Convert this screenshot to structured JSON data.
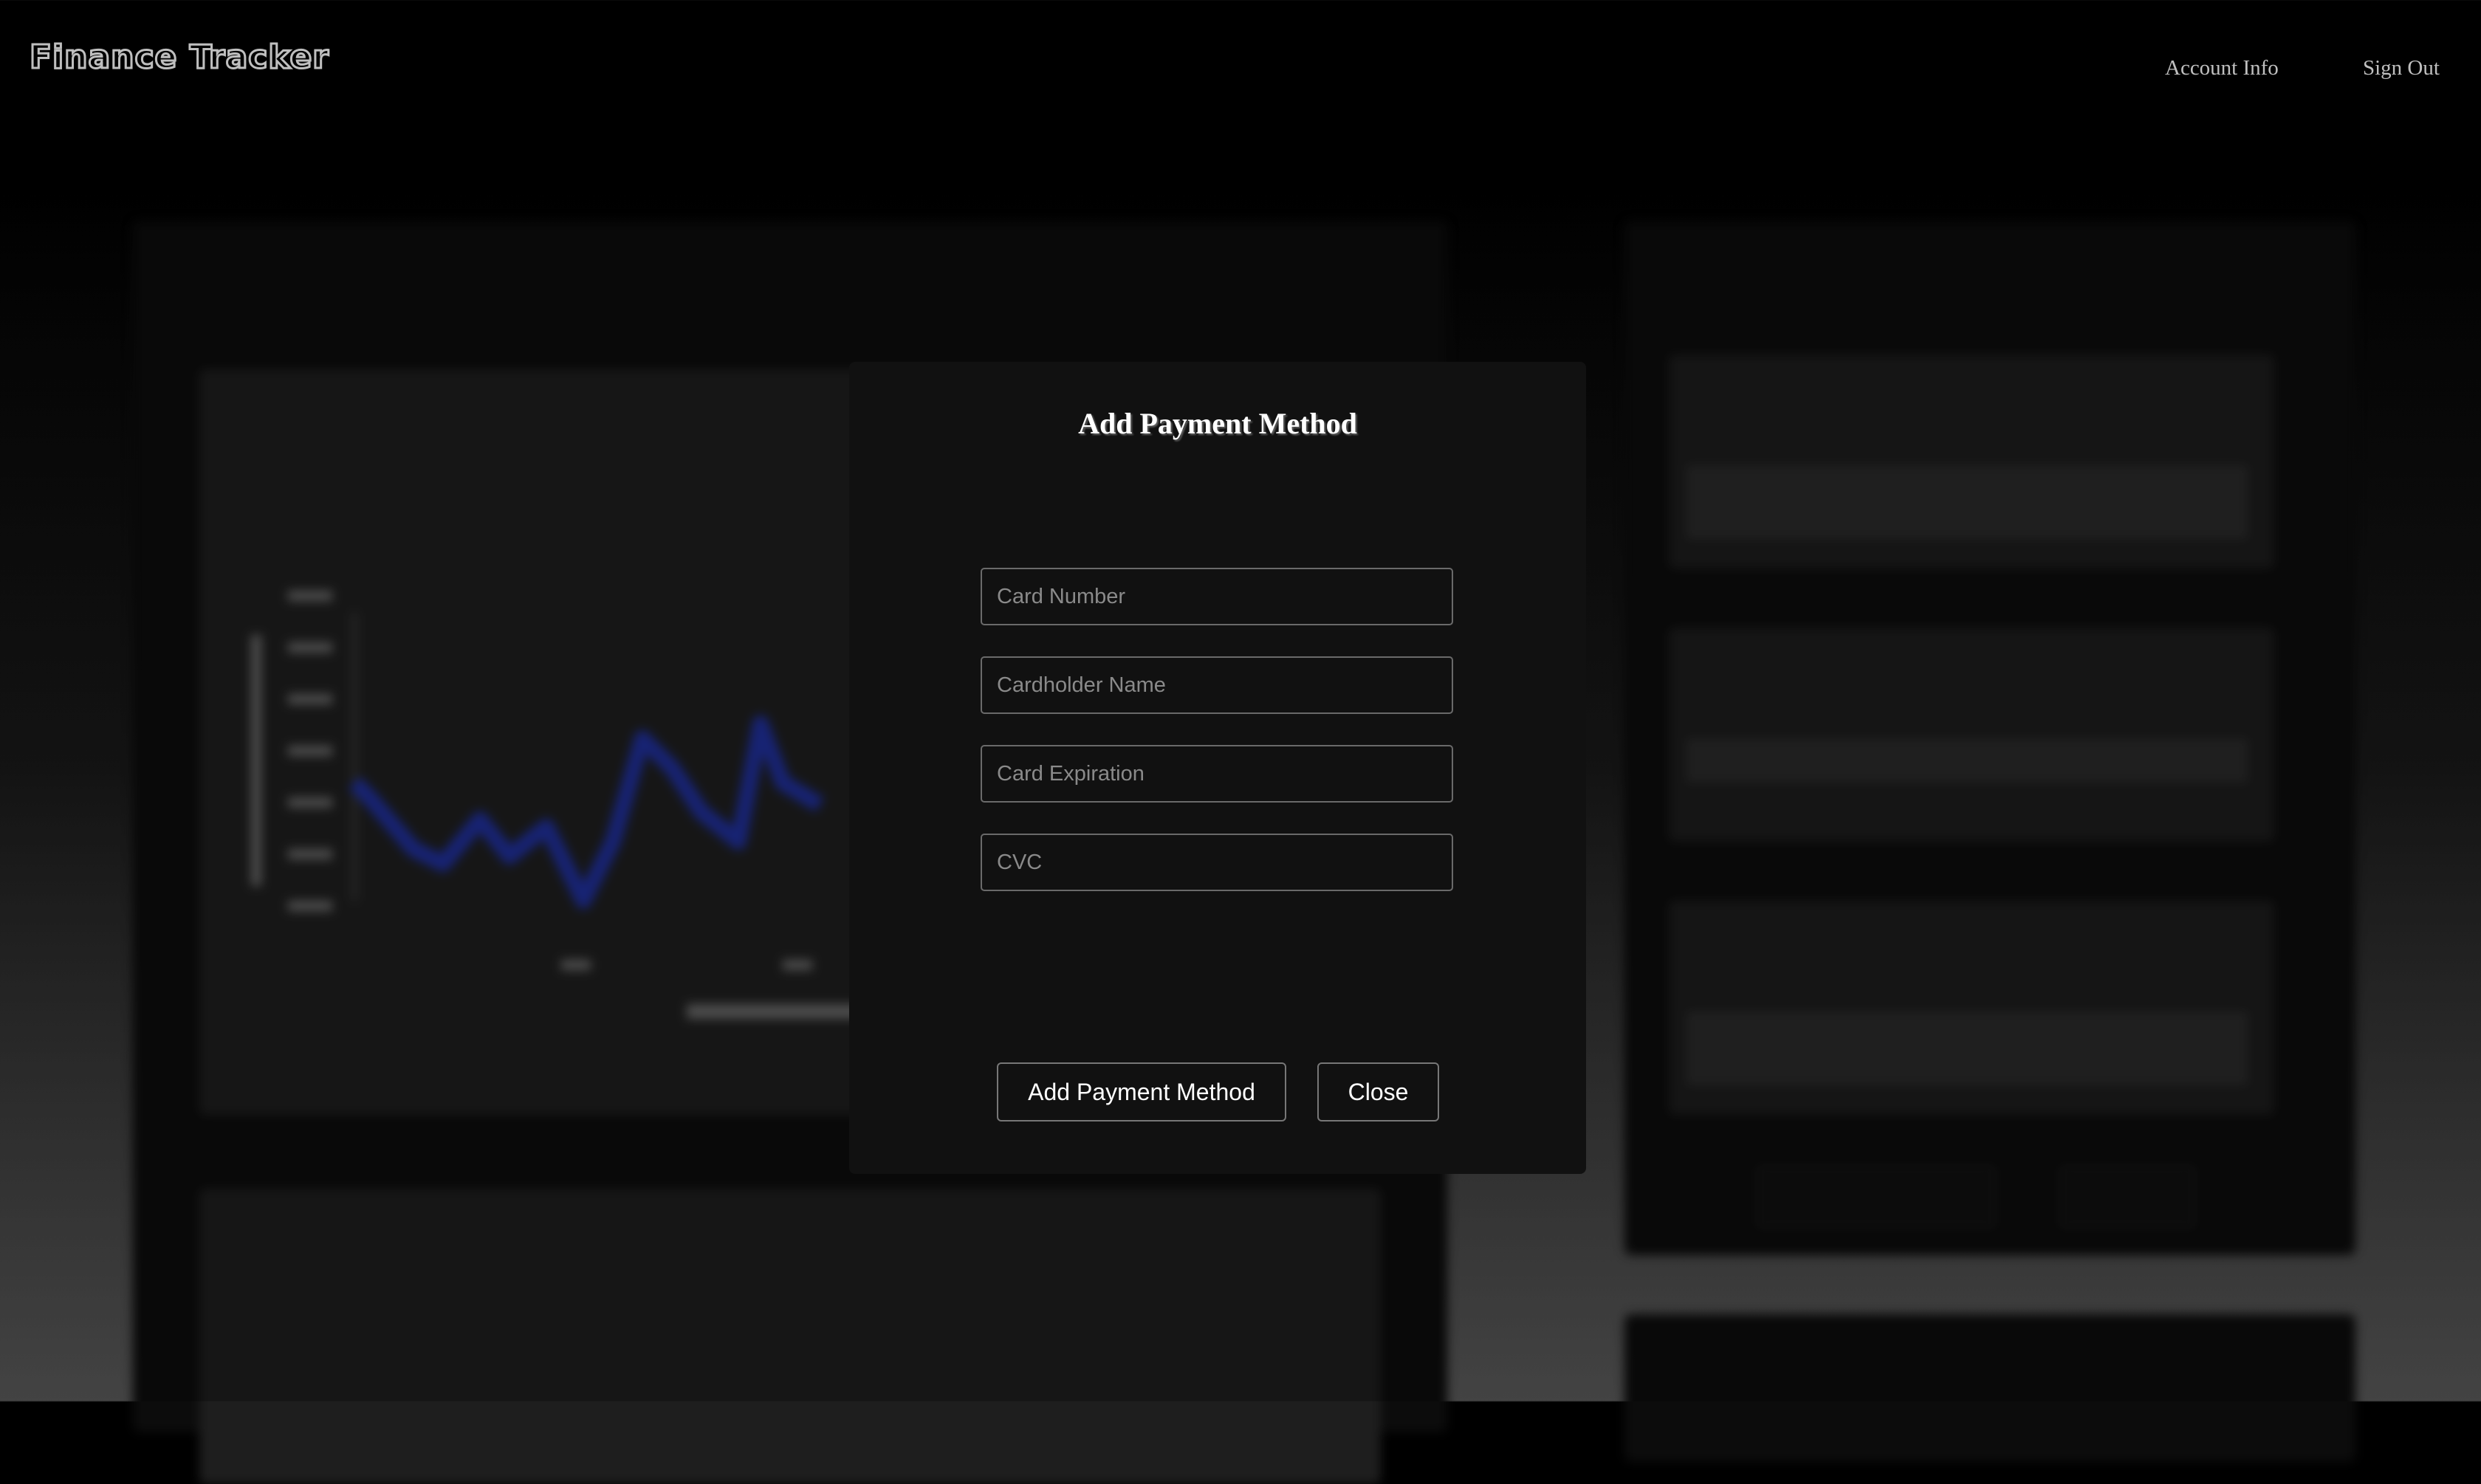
{
  "header": {
    "app_title": "Finance Tracker",
    "account_link": "Account Info",
    "signout_link": "Sign Out"
  },
  "modal": {
    "title": "Add Payment Method",
    "fields": [
      {
        "placeholder": "Card Number",
        "value": ""
      },
      {
        "placeholder": "Cardholder Name",
        "value": ""
      },
      {
        "placeholder": "Card Expiration",
        "value": ""
      },
      {
        "placeholder": "CVC",
        "value": ""
      }
    ],
    "submit_label": "Add Payment Method",
    "close_label": "Close"
  },
  "colors": {
    "modal_bg": "#111111",
    "chart_line": "#1f2f9a"
  }
}
